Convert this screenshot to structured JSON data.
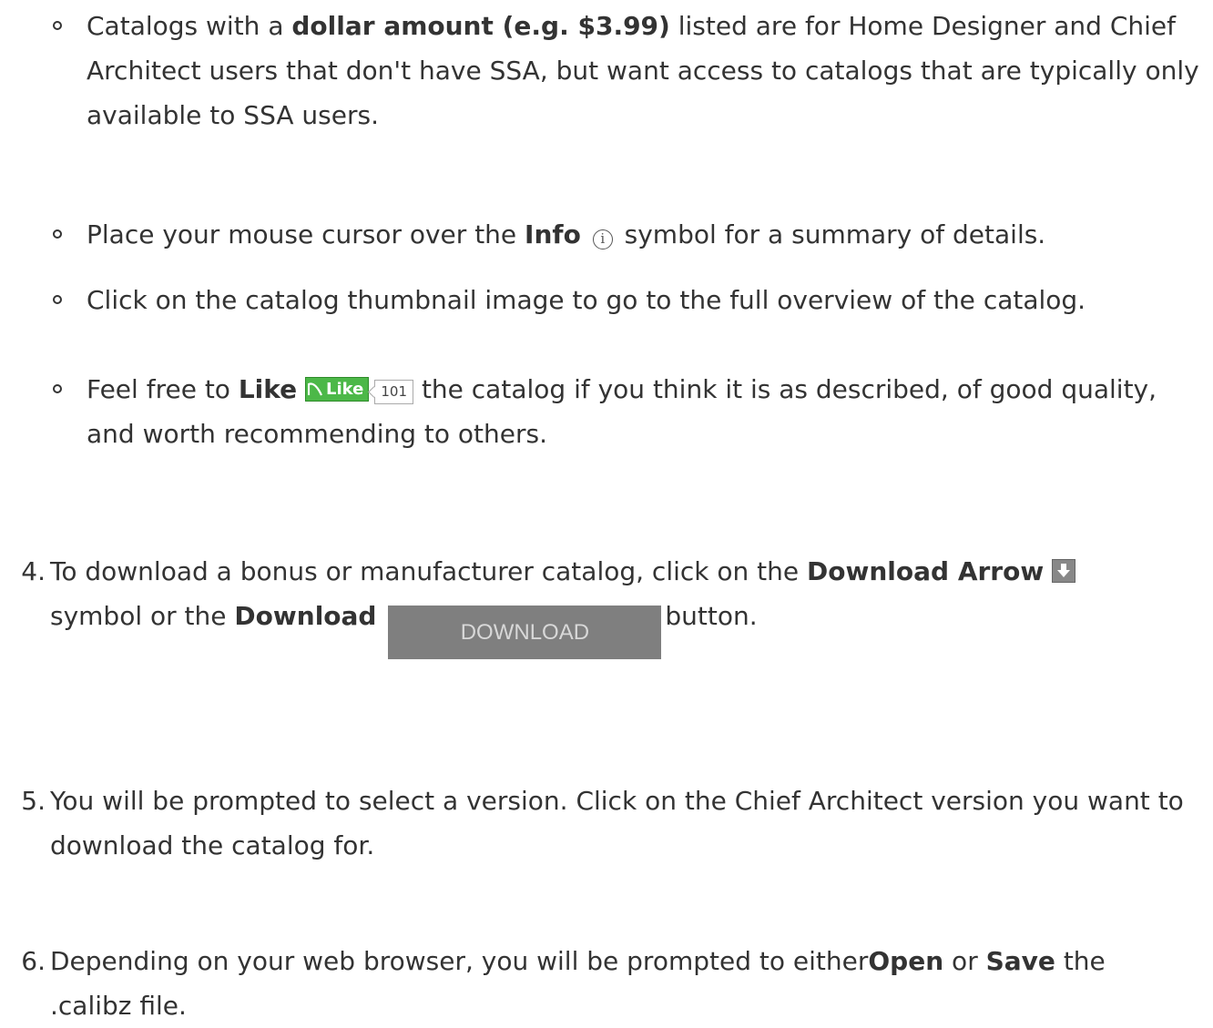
{
  "bullets": [
    {
      "pre": "Catalogs with a ",
      "bold": "dollar amount (e.g. $3.99)",
      "post": " listed are for Home Designer and Chief Architect users that don't have SSA, but want access to catalogs that are typically only available to SSA users."
    },
    {
      "pre": "Place your mouse cursor over the ",
      "bold": "Info",
      "icon": "info-icon",
      "icon_glyph": "i",
      "post": " symbol for a summary of details."
    },
    {
      "text": "Click on the catalog thumbnail image to go to the full overview of the catalog."
    },
    {
      "pre": "Feel free to ",
      "bold": "Like",
      "like_button_label": "Like",
      "like_count": "101",
      "post": " the catalog if you think it is as described, of good quality, and worth recommending to others."
    }
  ],
  "steps": [
    {
      "number": "4.",
      "pre": "To download a bonus or manufacturer catalog, click on the ",
      "bold1": "Download Arrow",
      "icon": "download-arrow-icon",
      "mid": "symbol or the ",
      "bold2": "Download",
      "button_label": "Download",
      "post": "button."
    },
    {
      "number": "5.",
      "text": "You will be prompted to select a version. Click on the Chief Architect version you want to download the catalog for."
    },
    {
      "number": "6.",
      "pre": "Depending on your web browser, you will be prompted to either",
      "bold1": "Open",
      "mid": " or ",
      "bold2": "Save",
      "post": " the .calibz file."
    }
  ],
  "colors": {
    "text": "#333333",
    "like_green": "#4cb848",
    "download_button_bg": "#7f7f7f"
  }
}
